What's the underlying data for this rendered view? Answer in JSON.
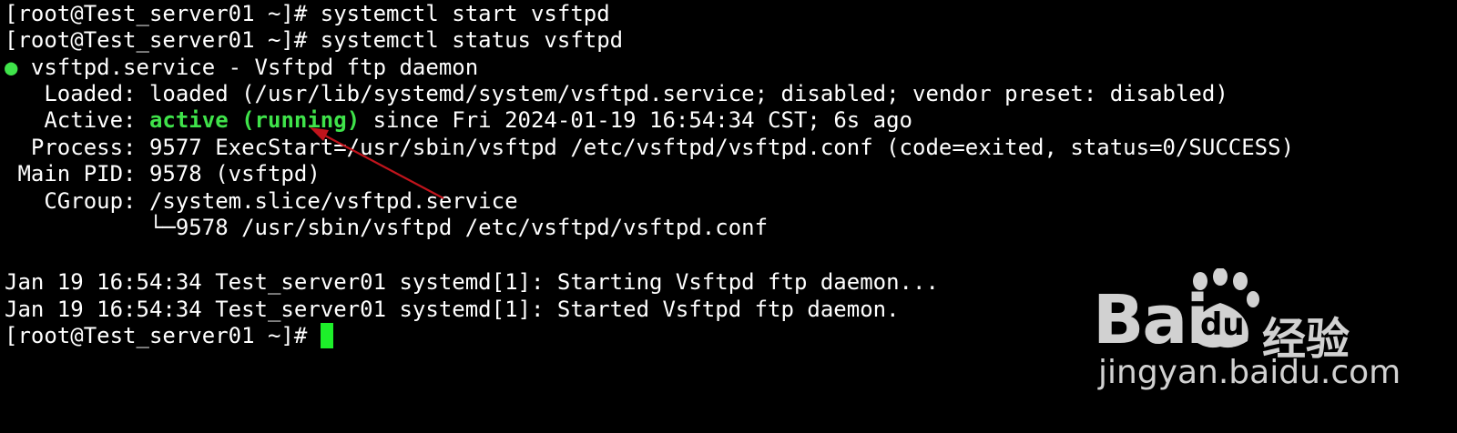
{
  "terminal": {
    "cmd1": {
      "prompt": "[root@Test_server01 ~]# ",
      "command": "systemctl start vsftpd"
    },
    "cmd2": {
      "prompt": "[root@Test_server01 ~]# ",
      "command": "systemctl status vsftpd"
    },
    "unit_bullet": "●",
    "unit_title": " vsftpd.service - Vsftpd ftp daemon",
    "loaded_line": "   Loaded: loaded (/usr/lib/systemd/system/vsftpd.service; disabled; vendor preset: disabled)",
    "active_label": "   Active: ",
    "active_state": "active (running)",
    "active_since": " since Fri 2024-01-19 16:54:34 CST; 6s ago",
    "process_line": "  Process: 9577 ExecStart=/usr/sbin/vsftpd /etc/vsftpd/vsftpd.conf (code=exited, status=0/SUCCESS)",
    "mainpid_line": " Main PID: 9578 (vsftpd)",
    "cgroup_line": "   CGroup: /system.slice/vsftpd.service",
    "cgroup_child_line": "           └─9578 /usr/sbin/vsftpd /etc/vsftpd/vsftpd.conf",
    "log1": "Jan 19 16:54:34 Test_server01 systemd[1]: Starting Vsftpd ftp daemon...",
    "log2": "Jan 19 16:54:34 Test_server01 systemd[1]: Started Vsftpd ftp daemon.",
    "final_prompt": "[root@Test_server01 ~]# "
  },
  "colors": {
    "background": "#000000",
    "text": "#ffffff",
    "active_green": "#3fe34a",
    "cursor_green": "#1df02a",
    "annotation_arrow": "#c0141c"
  },
  "watermark": {
    "brand": "Bai",
    "brand_du": "du",
    "brand_cn": "经验",
    "url": "jingyan.baidu.com"
  }
}
